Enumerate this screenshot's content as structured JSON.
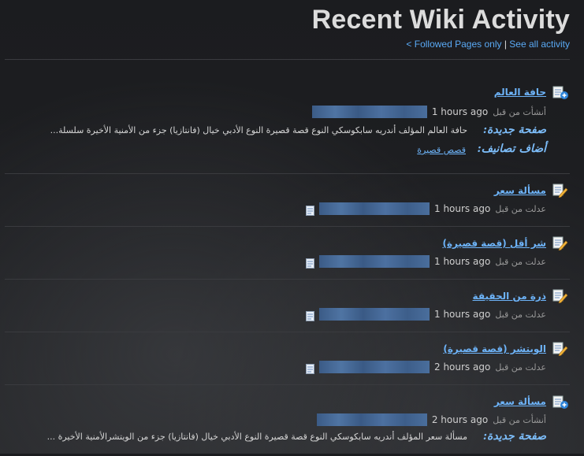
{
  "header": {
    "title": "Recent Wiki Activity",
    "followed_link": "< Followed Pages only",
    "separator": "|",
    "all_link": "See all activity"
  },
  "entries": [
    {
      "kind": "new",
      "title": "حافة العالم",
      "meta_label": "أنشأت من قبل",
      "time": "1 hours ago",
      "new_page_label": "صفحة جديدة:",
      "snippet": "حافة العالم المؤلف أندريه سابكوسكي النوع قصة قصيرة النوع الأدبي خيال (فانتازيا) جزء من الأمنية الأخيرة سلسلة...",
      "category_label": "أضاف تصانيف:",
      "category": "قصص قصيرة"
    },
    {
      "kind": "edit",
      "title": "مسألة سعر",
      "meta_label": "عدلت من قبل",
      "time": "1 hours ago"
    },
    {
      "kind": "edit",
      "title": "شر أقل (قصة قصيرة)",
      "meta_label": "عدلت من قبل",
      "time": "1 hours ago"
    },
    {
      "kind": "edit",
      "title": "ذرة من الحقيقة",
      "meta_label": "عدلت من قبل",
      "time": "1 hours ago"
    },
    {
      "kind": "edit",
      "title": "الويتشر (قصة قصيرة)",
      "meta_label": "عدلت من قبل",
      "time": "2 hours ago"
    },
    {
      "kind": "new",
      "title": "مسألة سعر",
      "meta_label": "أنشأت من قبل",
      "time": "2 hours ago",
      "new_page_label": "صفحة جديدة:",
      "snippet": "مسألة سعر المؤلف أندريه سابكوسكي النوع قصة قصيرة النوع الأدبي خيال (فانتازيا) جزء من الويتشرالأمنية الأخيرة ..."
    }
  ]
}
